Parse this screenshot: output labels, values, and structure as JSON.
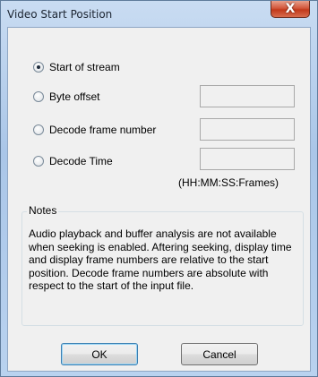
{
  "window": {
    "title": "Video Start Position",
    "close_glyph": "X"
  },
  "options": [
    {
      "label": "Start of stream",
      "checked": true
    },
    {
      "label": "Byte offset",
      "checked": false
    },
    {
      "label": "Decode frame number",
      "checked": false
    },
    {
      "label": "Decode Time",
      "checked": false
    }
  ],
  "fields": {
    "byte_offset": "",
    "decode_frame_number": "",
    "decode_time": ""
  },
  "time_format_hint": "(HH:MM:SS:Frames)",
  "notes": {
    "title": "Notes",
    "text": "Audio playback and buffer analysis are not available when seeking is enabled.  Aftering seeking, display time and display frame numbers are relative to the start position.  Decode frame numbers are absolute with respect to the start of the input file."
  },
  "buttons": {
    "ok": "OK",
    "cancel": "Cancel"
  }
}
